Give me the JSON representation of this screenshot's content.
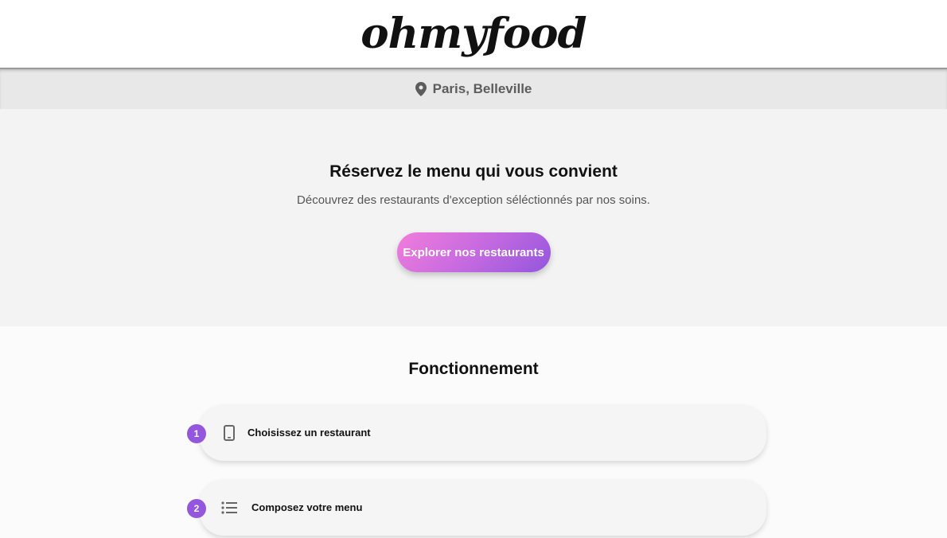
{
  "header": {
    "logo": "ohmyfood"
  },
  "location": {
    "icon": "map-pin-icon",
    "text": "Paris, Belleville"
  },
  "hero": {
    "title": "Réservez le menu qui vous convient",
    "subtitle": "Découvrez des restaurants d'exception séléctionnés par nos soins.",
    "cta_label": "Explorer nos restaurants"
  },
  "how": {
    "title": "Fonctionnement",
    "steps": [
      {
        "number": "1",
        "icon": "smartphone-icon",
        "label": "Choisissez un restaurant"
      },
      {
        "number": "2",
        "icon": "list-icon",
        "label": "Composez votre menu"
      }
    ]
  },
  "colors": {
    "accent": "#9356dc",
    "accent_pink": "#f27ddc",
    "hero_bg": "#f3f3f3",
    "location_bg": "#e8e8e8"
  }
}
